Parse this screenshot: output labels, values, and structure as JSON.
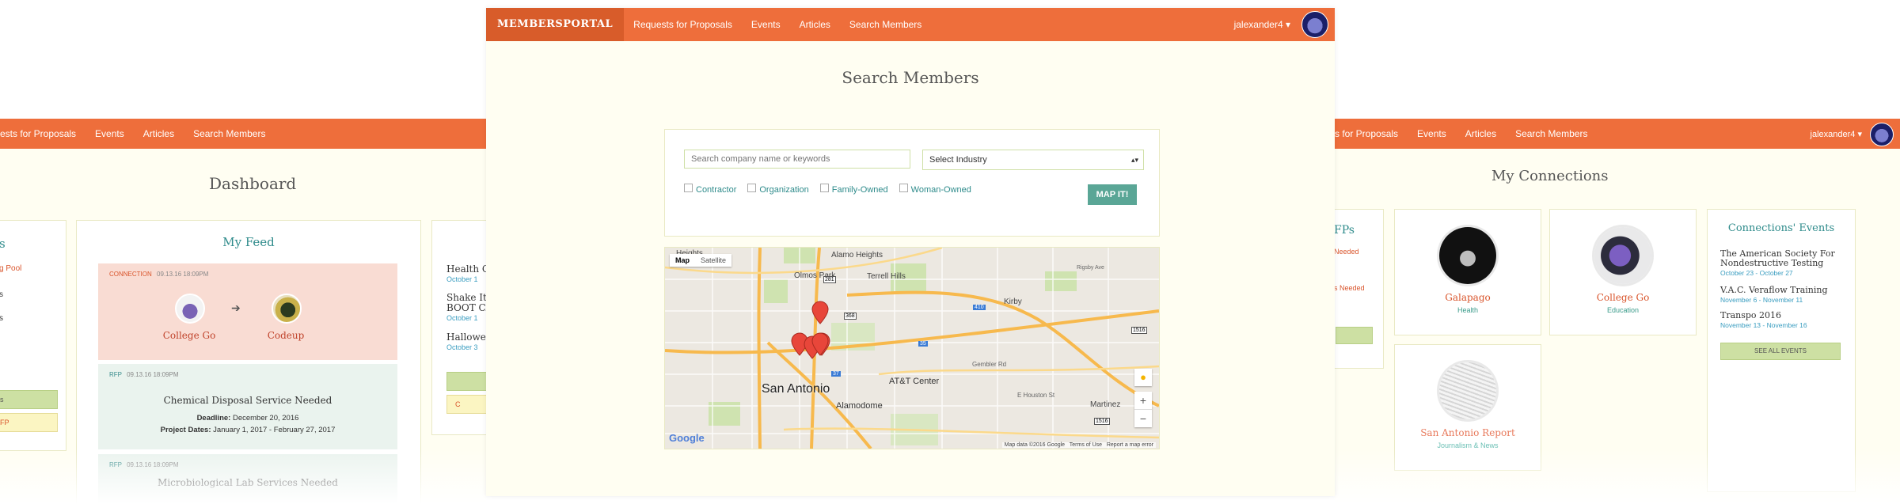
{
  "left": {
    "nav": {
      "items": [
        "ests for Proposals",
        "Events",
        "Articles",
        "Search Members"
      ]
    },
    "title": "Dashboard",
    "left_column": {
      "partial_title": "s",
      "items": [
        "g Pool",
        "s",
        "s"
      ],
      "button_label": "s",
      "button2_label": "FP"
    },
    "feed": {
      "title": "My Feed",
      "connection": {
        "type": "CONNECTION",
        "date": "09.13.16 18:09PM",
        "from": "College Go",
        "to": "Codeup"
      },
      "rfp": {
        "type": "RFP",
        "date": "09.13.16 18:09PM",
        "title": "Chemical Disposal Service Needed",
        "deadline_label": "Deadline:",
        "deadline": "December 20, 2016",
        "dates_label": "Project Dates:",
        "dates": "January 1, 2017 - February 27, 2017"
      },
      "rfp2": {
        "type": "RFP",
        "date": "09.13.16 18:09PM",
        "title": "Microbiological Lab Services Needed"
      }
    },
    "events_partial": [
      {
        "title": "Health C",
        "date": "October 1"
      },
      {
        "title": "Shake It",
        "title2": "BOOT CA",
        "date": "October 1"
      },
      {
        "title": "Hallowe",
        "date": "October 3"
      }
    ],
    "events_btn": "",
    "events_btn2": "C"
  },
  "center": {
    "brand": "MEMBERSPORTAL",
    "nav": {
      "items": [
        "Requests for Proposals",
        "Events",
        "Articles",
        "Search Members"
      ]
    },
    "user": "jalexander4",
    "title": "Search Members",
    "search": {
      "placeholder": "Search company name or keywords",
      "industry": "Select Industry",
      "filters": [
        "Contractor",
        "Organization",
        "Family-Owned",
        "Woman-Owned"
      ],
      "map_button": "MAP IT!"
    },
    "map": {
      "tab_map": "Map",
      "tab_satellite": "Satellite",
      "labels": [
        "Heights",
        "Alamo Heights",
        "Olmos Park",
        "Terrell Hills",
        "Kirby",
        "San Antonio",
        "AT&T Center",
        "Alamodome",
        "Gembler Rd",
        "E Houston St",
        "Martinez",
        "Rigsby Ave"
      ],
      "highways": [
        "281",
        "368",
        "410",
        "35",
        "37",
        "1516",
        "1516"
      ],
      "footer": "Map data ©2016 Google",
      "terms": "Terms of Use",
      "report": "Report a map error",
      "google": "Google"
    }
  },
  "right": {
    "nav": {
      "items": [
        "s for Proposals",
        "Events",
        "Articles",
        "Search Members"
      ]
    },
    "user": "jalexander4",
    "title": "My Connections",
    "left_partial": {
      "title": "FPs",
      "items": [
        "Needed",
        "s Needed"
      ]
    },
    "connections": [
      {
        "name": "Galapago",
        "category": "Health"
      },
      {
        "name": "College Go",
        "category": "Education"
      },
      {
        "name": "San Antonio Report",
        "category": "Journalism & News"
      }
    ],
    "events": {
      "title": "Connections' Events",
      "items": [
        {
          "title": "The American Society For Nondestructive Testing",
          "date": "October 23 - October 27"
        },
        {
          "title": "V.A.C. Veraflow Training",
          "date": "November 6 - November 11"
        },
        {
          "title": "Transpo 2016",
          "date": "November 13 - November 16"
        }
      ],
      "button": "SEE ALL EVENTS"
    }
  },
  "colors": {
    "accent": "#ee6e3b",
    "teal": "#2e8b8b",
    "green": "#6aa77a",
    "orange_text": "#d9542b"
  }
}
